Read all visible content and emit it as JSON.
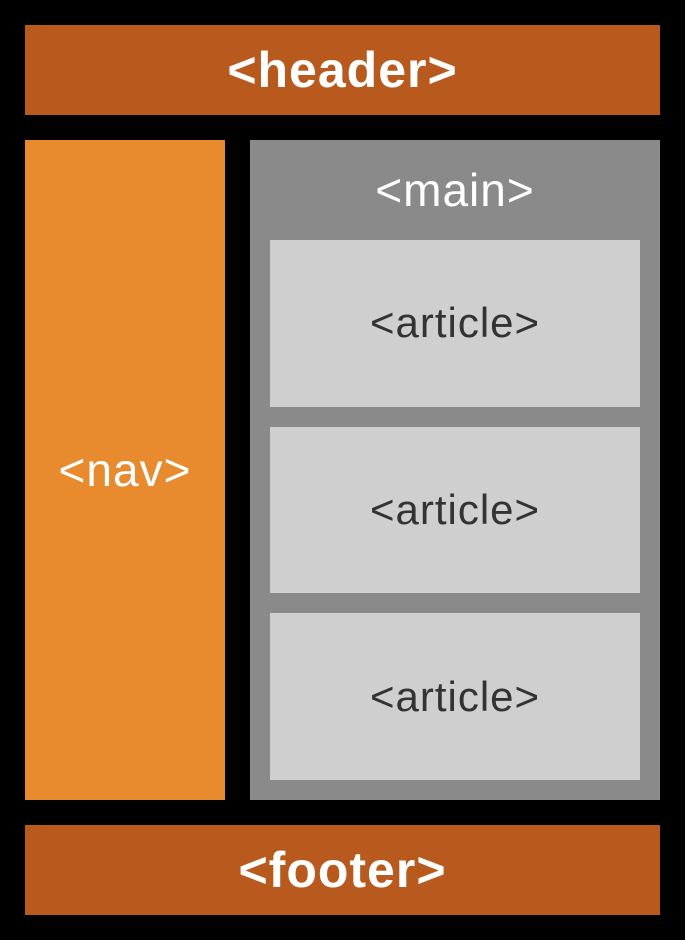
{
  "header": {
    "label": "<header>"
  },
  "nav": {
    "label": "<nav>"
  },
  "main": {
    "label": "<main>",
    "articles": [
      {
        "label": "<article>"
      },
      {
        "label": "<article>"
      },
      {
        "label": "<article>"
      }
    ]
  },
  "footer": {
    "label": "<footer>"
  },
  "colors": {
    "header_bg": "#B85A1E",
    "nav_bg": "#E88B2F",
    "main_bg": "#8A8A8A",
    "article_bg": "#CFCFCF",
    "page_bg": "#000000"
  }
}
